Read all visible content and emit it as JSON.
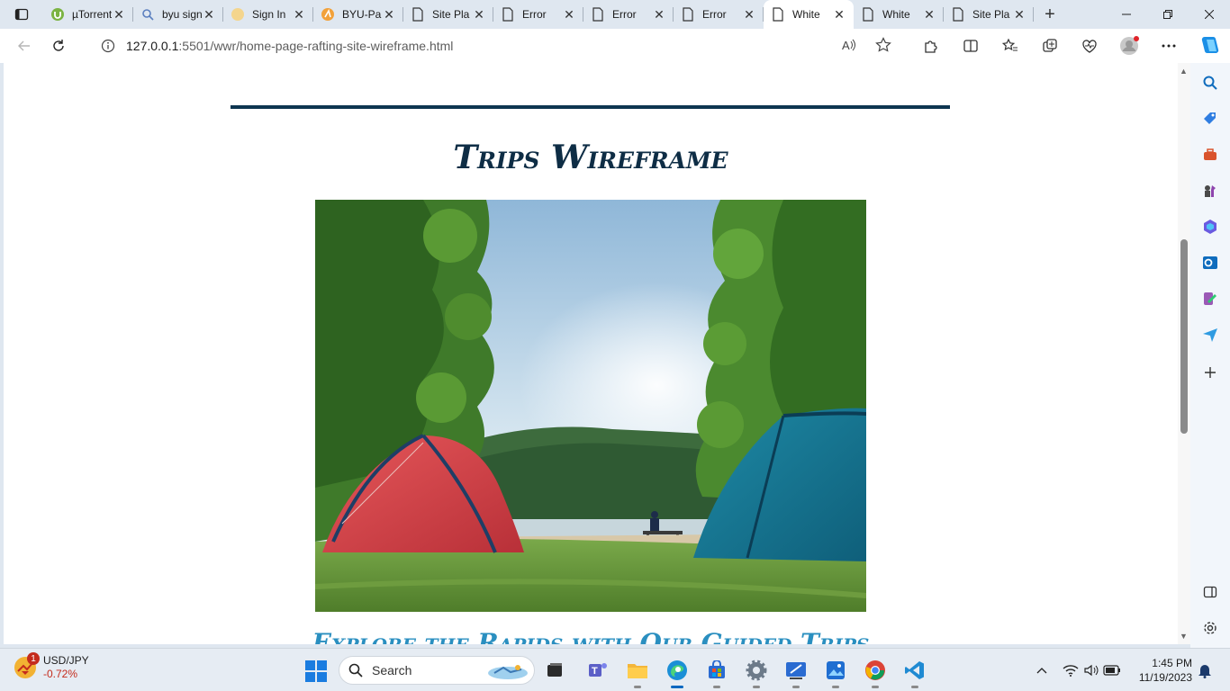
{
  "browser": {
    "tabs": [
      {
        "title": "µTorrent",
        "icon": "utorrent-icon",
        "active": false
      },
      {
        "title": "byu sign",
        "icon": "search-icon",
        "active": false
      },
      {
        "title": "Sign In",
        "icon": "byu-icon",
        "active": false
      },
      {
        "title": "BYU-Pa",
        "icon": "byu-pathway-icon",
        "active": false
      },
      {
        "title": "Site Pla",
        "icon": "page-icon",
        "active": false
      },
      {
        "title": "Error",
        "icon": "page-icon",
        "active": false
      },
      {
        "title": "Error",
        "icon": "page-icon",
        "active": false
      },
      {
        "title": "Error",
        "icon": "page-icon",
        "active": false
      },
      {
        "title": "White",
        "icon": "page-icon",
        "active": true
      },
      {
        "title": "White",
        "icon": "page-icon",
        "active": false
      },
      {
        "title": "Site Pla",
        "icon": "page-icon",
        "active": false
      }
    ],
    "url_host": "127.0.0.1",
    "url_rest": ":5501/wwr/home-page-rafting-site-wireframe.html"
  },
  "page": {
    "title": "Trips Wireframe",
    "hero_alt": "Two camping tents on grass by a lake",
    "subtitle": "Explore the Rapids with Our Guided Trips"
  },
  "taskbar": {
    "widget_title": "USD/JPY",
    "widget_value": "-0.72%",
    "widget_badge": "1",
    "search_label": "Search",
    "time": "1:45 PM",
    "date": "11/19/2023"
  },
  "colors": {
    "heading": "#0e2d45",
    "rule": "#0e3550",
    "subtitle": "#2a8fc0",
    "accent": "#0067c0"
  }
}
